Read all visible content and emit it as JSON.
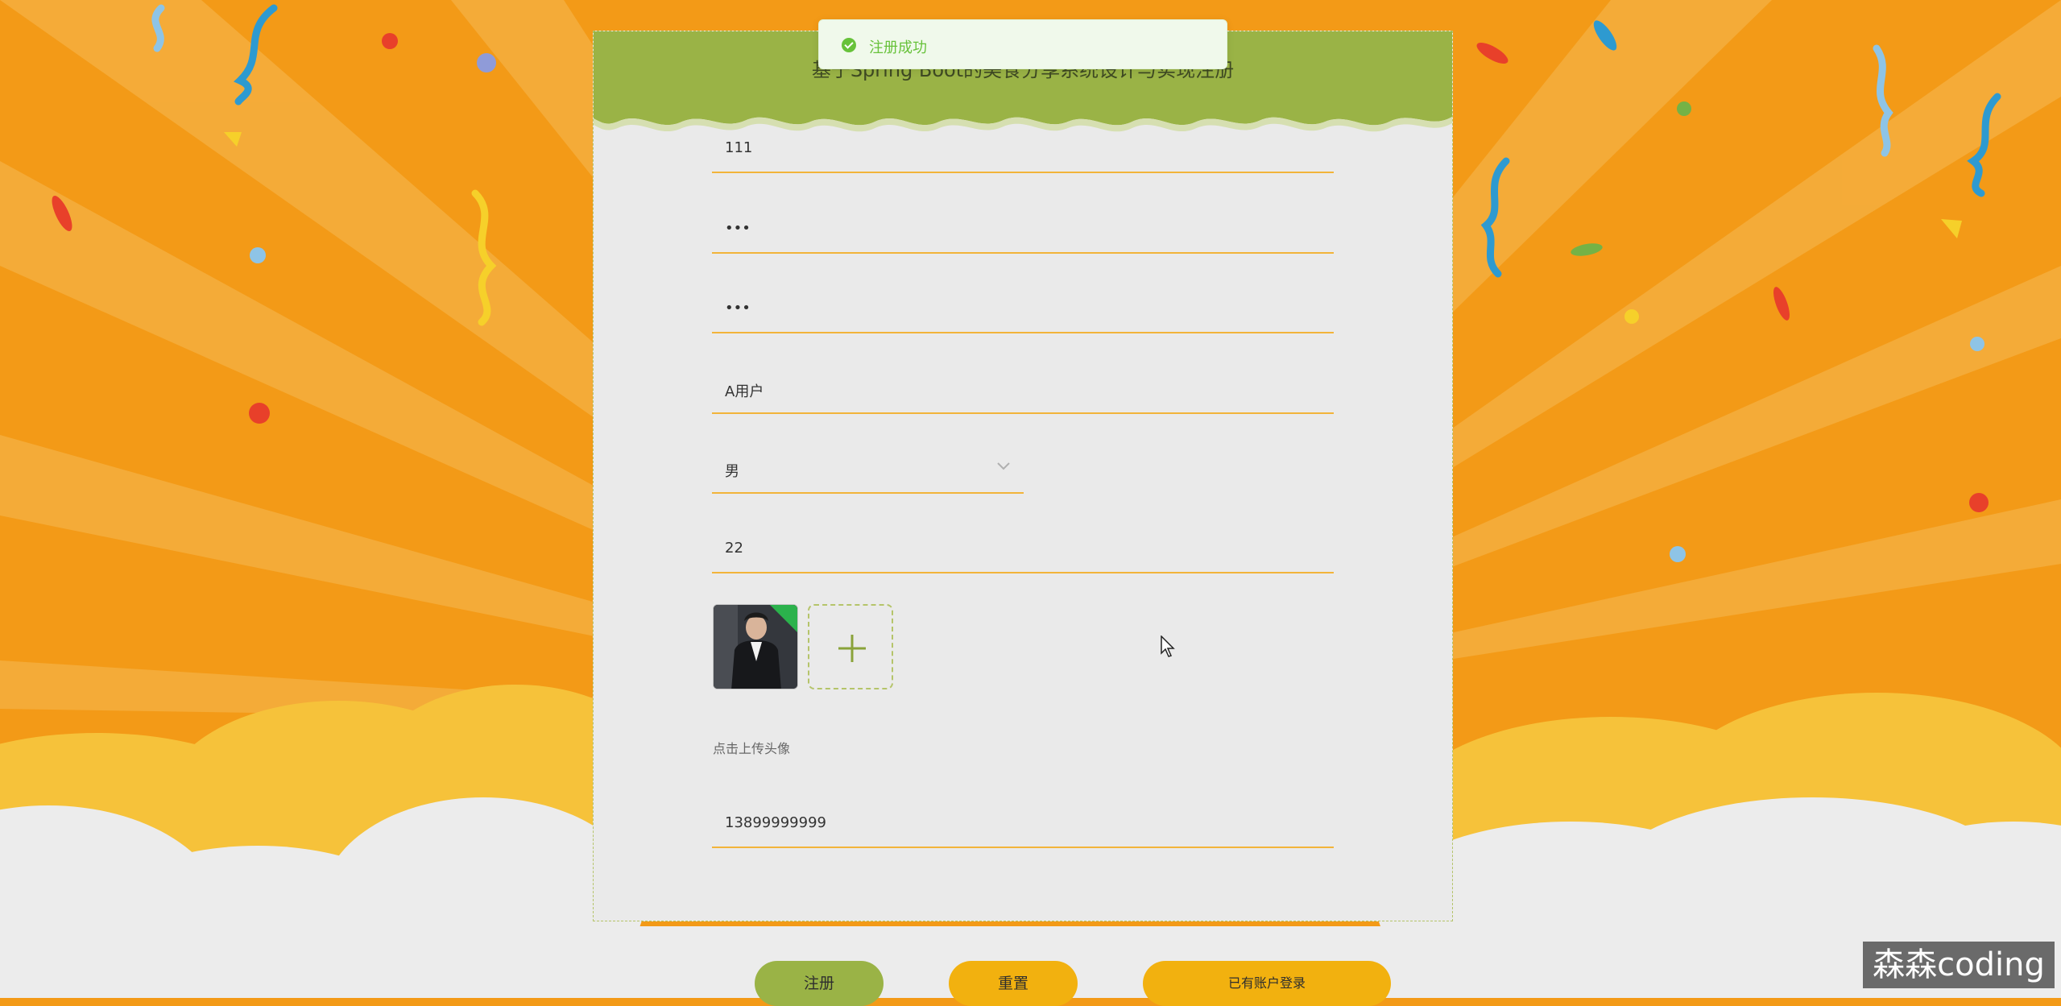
{
  "page": {
    "title": "基于Spring Boot的美食分享系统设计与实现注册"
  },
  "toast": {
    "message": "注册成功",
    "type": "success"
  },
  "form": {
    "account": {
      "value": "111"
    },
    "password": {
      "value": "•••"
    },
    "confirm_password": {
      "value": "•••"
    },
    "name": {
      "value": "A用户"
    },
    "gender": {
      "value": "男"
    },
    "age": {
      "value": "22"
    },
    "avatar": {
      "hint": "点击上传头像",
      "upload_icon": "plus-icon"
    },
    "phone": {
      "value": "13899999999"
    }
  },
  "buttons": {
    "register": "注册",
    "reset": "重置",
    "login": "已有账户登录"
  },
  "colors": {
    "background": "#f39a17",
    "header": "#9ab346",
    "field_underline": "#f2b43a",
    "register_button": "#9ab346",
    "secondary_button": "#f2b10f",
    "toast_text": "#67c23a"
  },
  "watermark": "森森coding"
}
